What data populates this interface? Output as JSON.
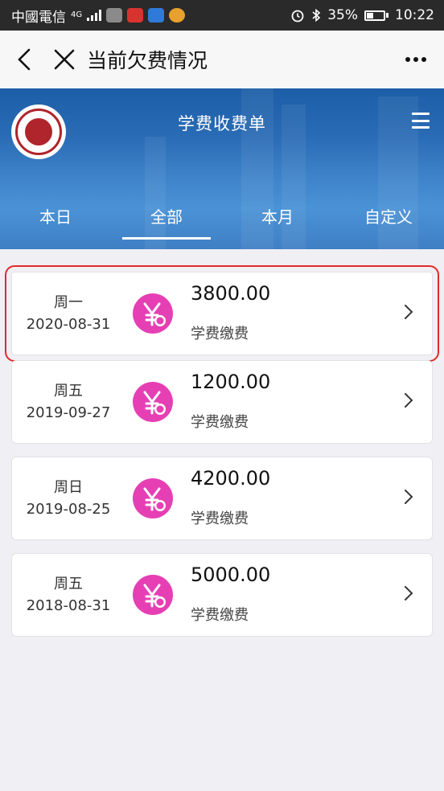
{
  "status_bar": {
    "carrier": "中國電信",
    "network": "4G",
    "battery": "35%",
    "time": "10:22"
  },
  "title_bar": {
    "title": "当前欠费情况"
  },
  "header": {
    "title": "学费收费单",
    "tabs": [
      "本日",
      "全部",
      "本月",
      "自定义"
    ],
    "active_tab": 1
  },
  "records": [
    {
      "weekday": "周一",
      "date": "2020-08-31",
      "amount": "3800.00",
      "label": "学费缴费"
    },
    {
      "weekday": "周五",
      "date": "2019-09-27",
      "amount": "1200.00",
      "label": "学费缴费"
    },
    {
      "weekday": "周日",
      "date": "2019-08-25",
      "amount": "4200.00",
      "label": "学费缴费"
    },
    {
      "weekday": "周五",
      "date": "2018-08-31",
      "amount": "5000.00",
      "label": "学费缴费"
    }
  ],
  "colors": {
    "accent_pink": "#e63fb4",
    "highlight_red": "#e02a2a",
    "header_blue": "#2a6bb5"
  },
  "icons": {
    "back": "chevron-left-icon",
    "close": "close-icon",
    "more": "more-dots-icon",
    "menu": "hamburger-menu-icon",
    "coin": "yuan-coin-icon",
    "row_arrow": "chevron-right-icon"
  }
}
